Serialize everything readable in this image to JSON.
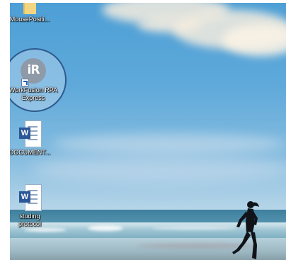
{
  "desktop": {
    "icons": [
      {
        "label": "MousePositi...",
        "icon": "folder-icon"
      },
      {
        "label": "WorkFusion RPA Express",
        "icon": "rpa-express-icon",
        "glyph": "iR",
        "highlighted": true
      },
      {
        "label": "DOCUMENT...",
        "icon": "word-document-icon",
        "glyph": "W"
      },
      {
        "label": "studing protocol",
        "icon": "word-document-icon",
        "glyph": "W"
      }
    ]
  },
  "colors": {
    "sky_top": "#4d9fd6",
    "sea": "#3e7f9e",
    "highlight_ring": "#2e5a8e",
    "word_blue": "#2b5797",
    "folder_yellow": "#e7c05c"
  }
}
